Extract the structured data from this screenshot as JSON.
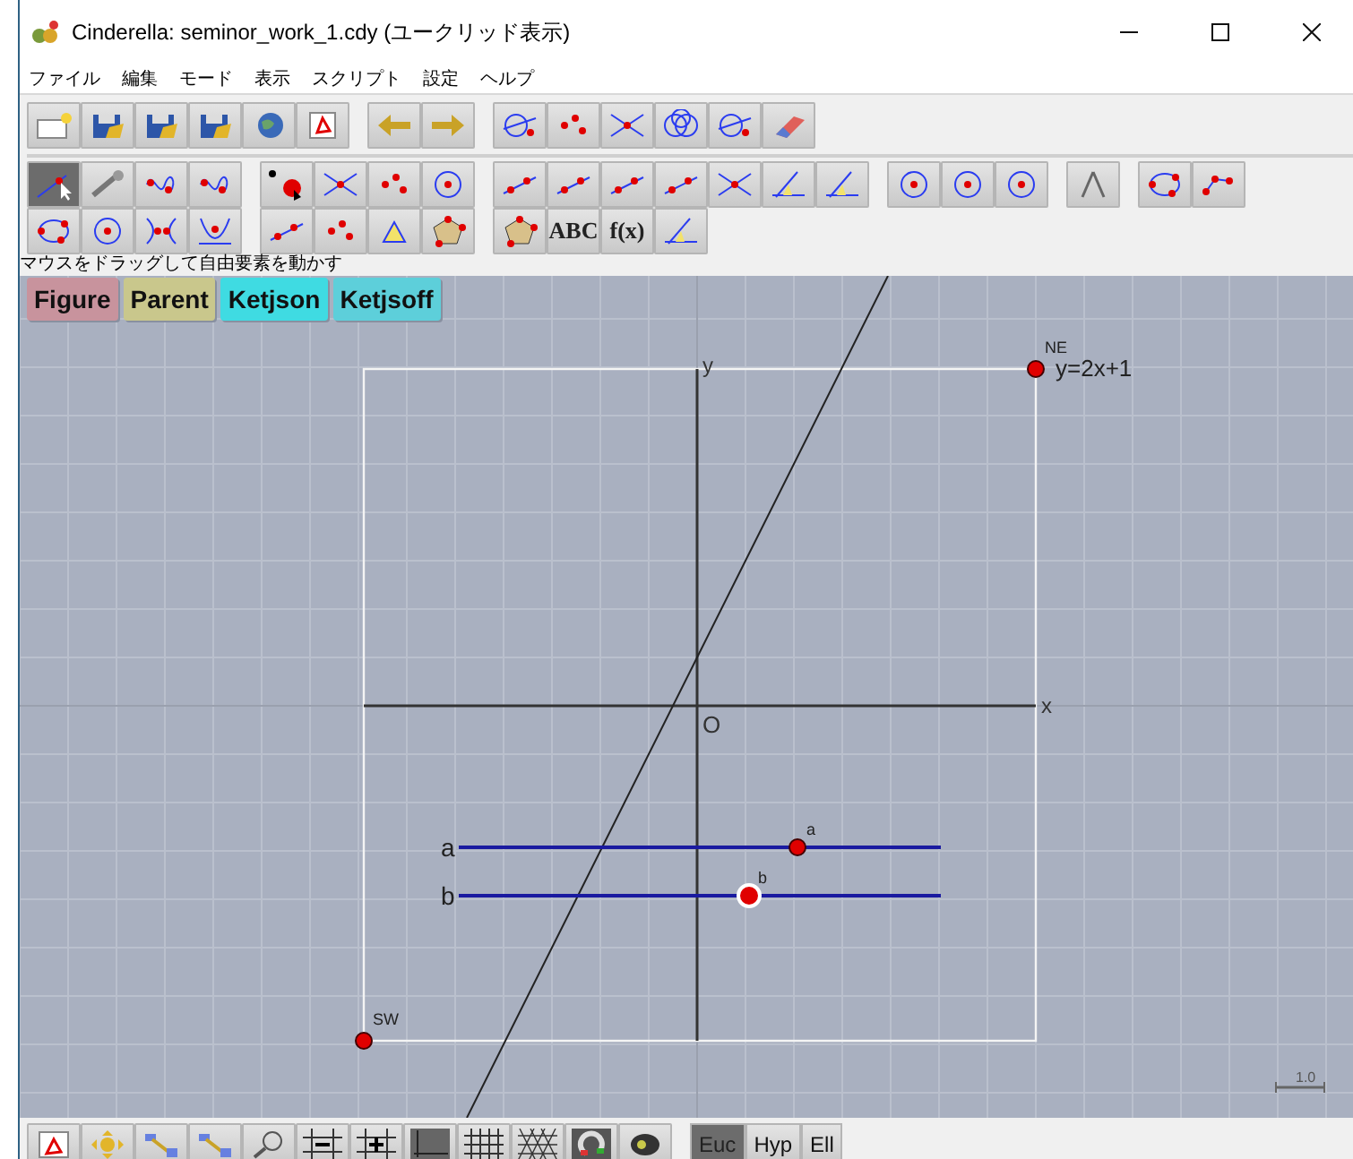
{
  "window": {
    "title": "Cinderella: seminor_work_1.cdy (ユークリッド表示)"
  },
  "menu": [
    "ファイル",
    "編集",
    "モード",
    "表示",
    "スクリプト",
    "設定",
    "ヘルプ"
  ],
  "toolbar_rows": [
    [
      [
        {
          "selected": false
        },
        {
          "selected": false
        },
        {
          "selected": false
        },
        {
          "selected": false
        },
        {
          "selected": false
        },
        {
          "selected": false
        }
      ],
      [
        {
          "selected": false
        },
        {
          "selected": false
        }
      ],
      [
        {
          "selected": false
        },
        {
          "selected": false
        },
        {
          "selected": false
        },
        {
          "selected": false
        },
        {
          "selected": false
        },
        {
          "selected": false
        }
      ]
    ],
    [
      [
        {
          "selected": true
        },
        {
          "selected": false
        },
        {
          "selected": false
        },
        {
          "selected": false
        }
      ],
      [
        {
          "selected": false
        },
        {
          "selected": false
        },
        {
          "selected": false
        },
        {
          "selected": false
        }
      ],
      [
        {
          "selected": false
        },
        {
          "selected": false
        },
        {
          "selected": false
        },
        {
          "selected": false
        },
        {
          "selected": false
        },
        {
          "selected": false
        },
        {
          "selected": false
        }
      ],
      [
        {
          "selected": false
        },
        {
          "selected": false
        },
        {
          "selected": false
        }
      ],
      [
        {
          "selected": false
        }
      ],
      [
        {
          "selected": false
        },
        {
          "selected": false
        }
      ]
    ],
    [
      [
        {
          "selected": false
        },
        {
          "selected": false
        },
        {
          "selected": false
        },
        {
          "selected": false
        }
      ],
      [
        {
          "selected": false
        },
        {
          "selected": false
        },
        {
          "selected": false
        },
        {
          "selected": false
        }
      ],
      [
        {
          "selected": false
        },
        {
          "label": "ABC",
          "selected": false
        },
        {
          "label": "f(x)",
          "selected": false
        },
        {
          "selected": false
        }
      ]
    ]
  ],
  "status": "マウスをドラッグして自由要素を動かす",
  "canvas": {
    "buttons": [
      {
        "label": "Figure",
        "color": "#c8939d"
      },
      {
        "label": "Parent",
        "color": "#c9c78c"
      },
      {
        "label": "Ketjson",
        "color": "#3fdbe2"
      },
      {
        "label": "Ketjsoff",
        "color": "#5dcfda"
      }
    ],
    "axis_labels": {
      "x": "x",
      "y": "y",
      "origin": "O"
    },
    "function_label": "y=2x+1",
    "corner_points": [
      {
        "label": "NE"
      },
      {
        "label": "SW"
      }
    ],
    "segments": [
      {
        "label": "a",
        "point_label": "a",
        "highlighted": false
      },
      {
        "label": "b",
        "point_label": "b",
        "highlighted": true
      }
    ],
    "scale_label": "1.0"
  },
  "bottom_toolbar": {
    "tools": [
      {
        "selected": false
      },
      {
        "selected": false
      },
      {
        "selected": false
      },
      {
        "selected": false
      },
      {
        "selected": false
      },
      {
        "selected": false
      },
      {
        "selected": false
      },
      {
        "selected": false
      },
      {
        "selected": false
      },
      {
        "selected": false
      },
      {
        "selected": false
      },
      {
        "selected": false
      }
    ],
    "geometry_modes": [
      {
        "label": "Euc",
        "selected": true
      },
      {
        "label": "Hyp",
        "selected": false
      },
      {
        "label": "Ell",
        "selected": false
      }
    ]
  }
}
